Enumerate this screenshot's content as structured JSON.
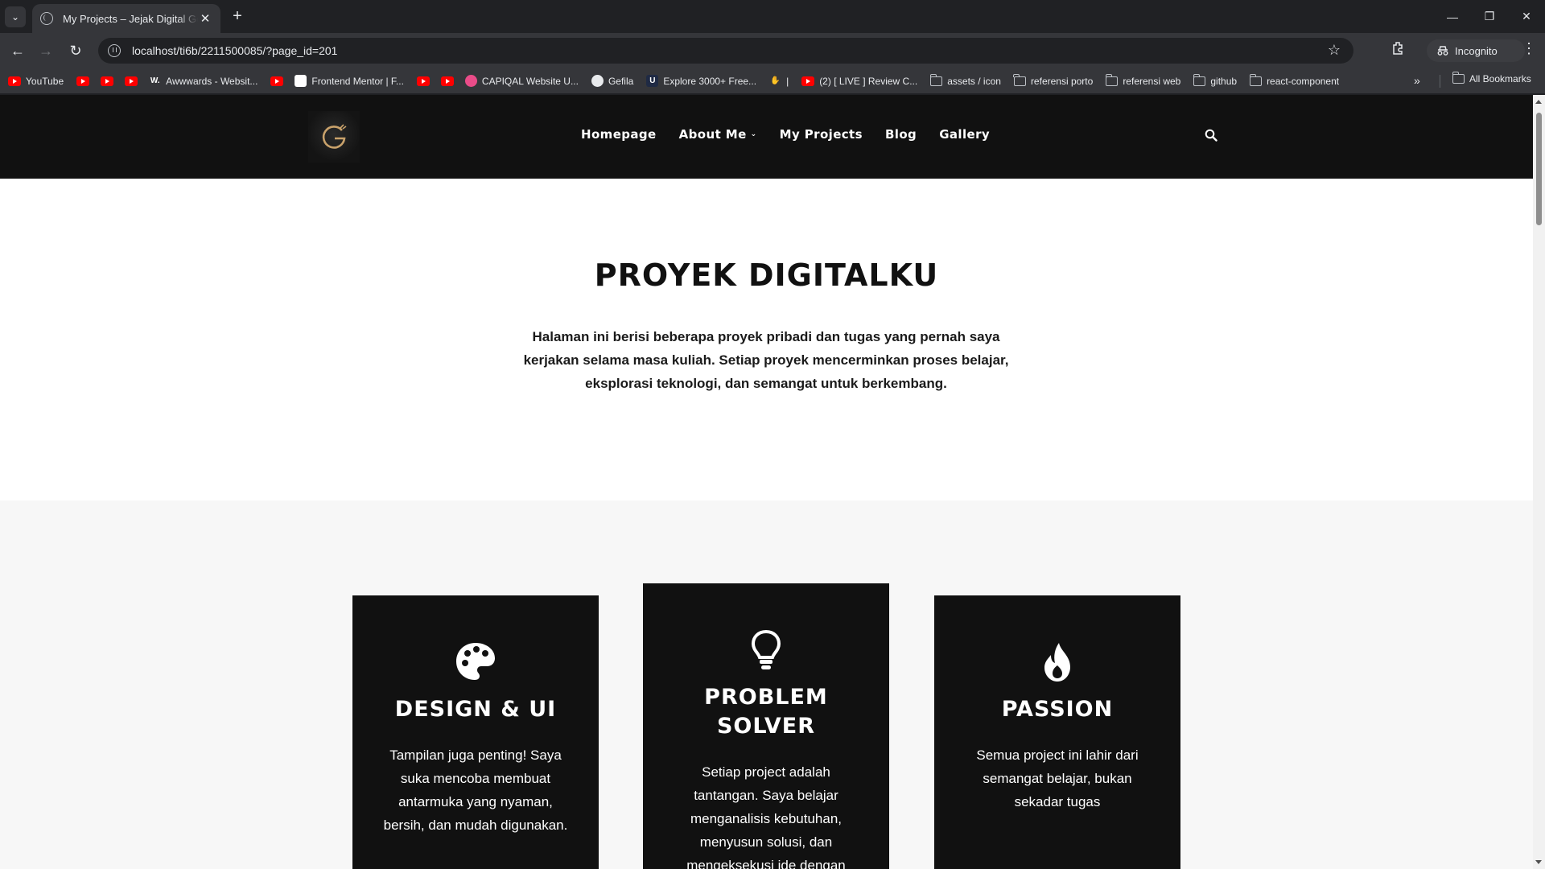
{
  "browser": {
    "tab_title": "My Projects – Jejak Digital Gefila",
    "url": "localhost/ti6b/2211500085/?page_id=201",
    "profile_label": "Incognito",
    "bookmarks": [
      {
        "label": "YouTube",
        "icon": "youtube"
      },
      {
        "label": "",
        "icon": "youtube"
      },
      {
        "label": "",
        "icon": "youtube"
      },
      {
        "label": "",
        "icon": "youtube"
      },
      {
        "label": "Awwwards - Websit...",
        "icon": "awwwards"
      },
      {
        "label": "",
        "icon": "youtube"
      },
      {
        "label": "Frontend Mentor | F...",
        "icon": "frontend-mentor"
      },
      {
        "label": "",
        "icon": "youtube"
      },
      {
        "label": "",
        "icon": "youtube"
      },
      {
        "label": "CAPIQAL Website U...",
        "icon": "dribbble"
      },
      {
        "label": "Gefila",
        "icon": "github"
      },
      {
        "label": "Explore 3000+ Free...",
        "icon": "uiverse"
      },
      {
        "label": "|",
        "icon": "hand"
      },
      {
        "label": "(2) [ LIVE ] Review C...",
        "icon": "youtube"
      },
      {
        "label": "assets / icon",
        "icon": "folder"
      },
      {
        "label": "referensi porto",
        "icon": "folder"
      },
      {
        "label": "referensi web",
        "icon": "folder"
      },
      {
        "label": "github",
        "icon": "folder"
      },
      {
        "label": "react-component",
        "icon": "folder"
      }
    ],
    "all_bookmarks_label": "All Bookmarks"
  },
  "site": {
    "nav": [
      {
        "label": "Homepage",
        "has_dropdown": false
      },
      {
        "label": "About Me",
        "has_dropdown": true
      },
      {
        "label": "My Projects",
        "has_dropdown": false
      },
      {
        "label": "Blog",
        "has_dropdown": false
      },
      {
        "label": "Gallery",
        "has_dropdown": false
      }
    ]
  },
  "hero": {
    "title": "PROYEK DIGITALKU",
    "description": "Halaman ini berisi beberapa proyek pribadi dan tugas yang pernah saya kerjakan selama masa kuliah. Setiap proyek mencerminkan proses belajar, eksplorasi teknologi, dan semangat untuk berkembang."
  },
  "cards": [
    {
      "icon": "palette-icon",
      "title": "DESIGN & UI",
      "text": "Tampilan juga penting! Saya suka mencoba membuat antarmuka yang nyaman, bersih, dan mudah digunakan."
    },
    {
      "icon": "lightbulb-icon",
      "title": "PROBLEM SOLVER",
      "text": "Setiap project adalah tantangan. Saya belajar menganalisis kebutuhan, menyusun solusi, dan mengeksekusi ide dengan"
    },
    {
      "icon": "fire-icon",
      "title": "PASSION",
      "text": "Semua project ini lahir dari semangat belajar, bukan sekadar tugas"
    }
  ],
  "colors": {
    "header_bg": "#111111",
    "card_bg": "#111111",
    "section_bg": "#f7f7f7",
    "logo_accent": "#c9a26b"
  }
}
